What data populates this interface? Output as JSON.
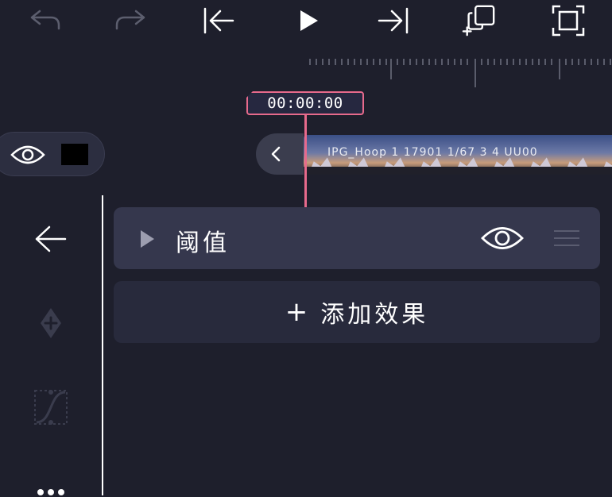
{
  "toolbar": {
    "undo_icon": "undo-icon",
    "redo_icon": "redo-icon",
    "skip_start_icon": "skip-to-start-icon",
    "play_icon": "play-icon",
    "skip_end_icon": "skip-to-end-icon",
    "duplicate_icon": "duplicate-icon",
    "fullscreen_icon": "fullscreen-icon"
  },
  "timeline": {
    "timecode": "00:00:00",
    "clip_label": "IPG_Hoop 1 17901 1/67 3 4 UU00",
    "playhead_color": "#e76a8c"
  },
  "effects_panel": {
    "effect_name": "阈值",
    "add_effect_plus": "+",
    "add_effect_label": "添加效果"
  },
  "colors": {
    "background": "#1e1f2c",
    "card": "#35374d",
    "add_card": "#282a3c",
    "accent": "#e76a8c"
  }
}
